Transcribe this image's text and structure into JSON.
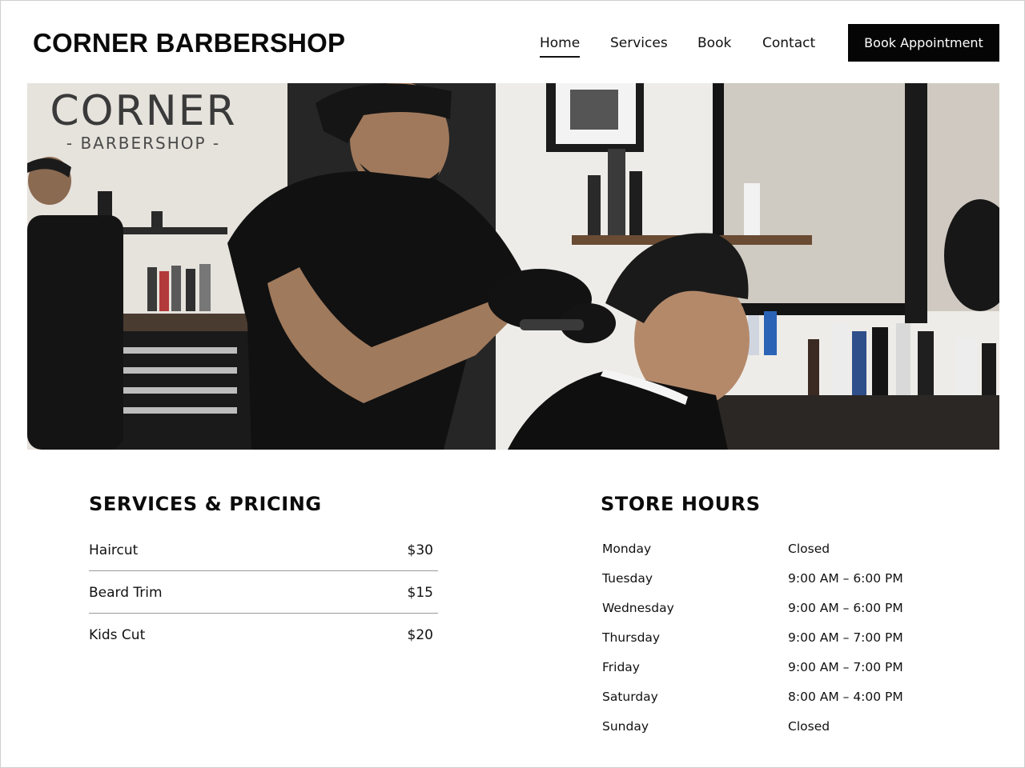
{
  "brand": {
    "name": "CORNER BARBERSHOP"
  },
  "nav": {
    "items": [
      {
        "label": "Home",
        "active": true
      },
      {
        "label": "Services",
        "active": false
      },
      {
        "label": "Book",
        "active": false
      },
      {
        "label": "Contact",
        "active": false
      }
    ],
    "cta_label": "Book Appointment"
  },
  "hero": {
    "sign_main": "CORNER",
    "sign_sub": "- BARBERSHOP -"
  },
  "services": {
    "title": "SERVICES & PRICING",
    "items": [
      {
        "name": "Haircut",
        "price": "$30"
      },
      {
        "name": "Beard Trim",
        "price": "$15"
      },
      {
        "name": "Kids Cut",
        "price": "$20"
      }
    ]
  },
  "hours": {
    "title": "STORE HOURS",
    "days": [
      {
        "day": "Monday",
        "time": "Closed"
      },
      {
        "day": "Tuesday",
        "time": "9:00 AM – 6:00 PM"
      },
      {
        "day": "Wednesday",
        "time": "9:00 AM – 6:00 PM"
      },
      {
        "day": "Thursday",
        "time": "9:00 AM – 7:00 PM"
      },
      {
        "day": "Friday",
        "time": "9:00 AM – 7:00 PM"
      },
      {
        "day": "Saturday",
        "time": "8:00 AM – 4:00 PM"
      },
      {
        "day": "Sunday",
        "time": "Closed"
      }
    ]
  },
  "colors": {
    "accent": "#050505",
    "background": "#ffffff",
    "divider": "#9a9a9a"
  }
}
